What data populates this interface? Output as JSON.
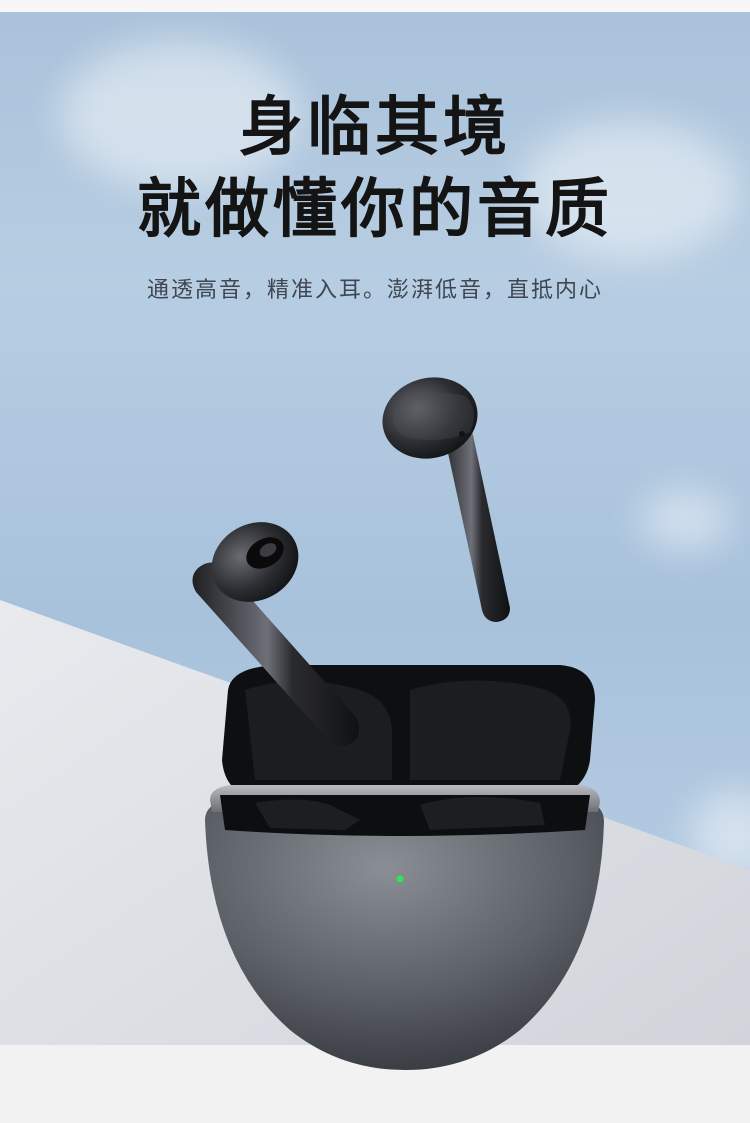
{
  "headline": {
    "line1": "身临其境",
    "line2": "就做懂你的音质"
  },
  "subheadline": "通透高音，精准入耳。澎湃低音，直抵内心",
  "product": {
    "name": "earbuds-charging-case",
    "indicator_color": "#2ee84f",
    "body_color": "#5d6168"
  }
}
